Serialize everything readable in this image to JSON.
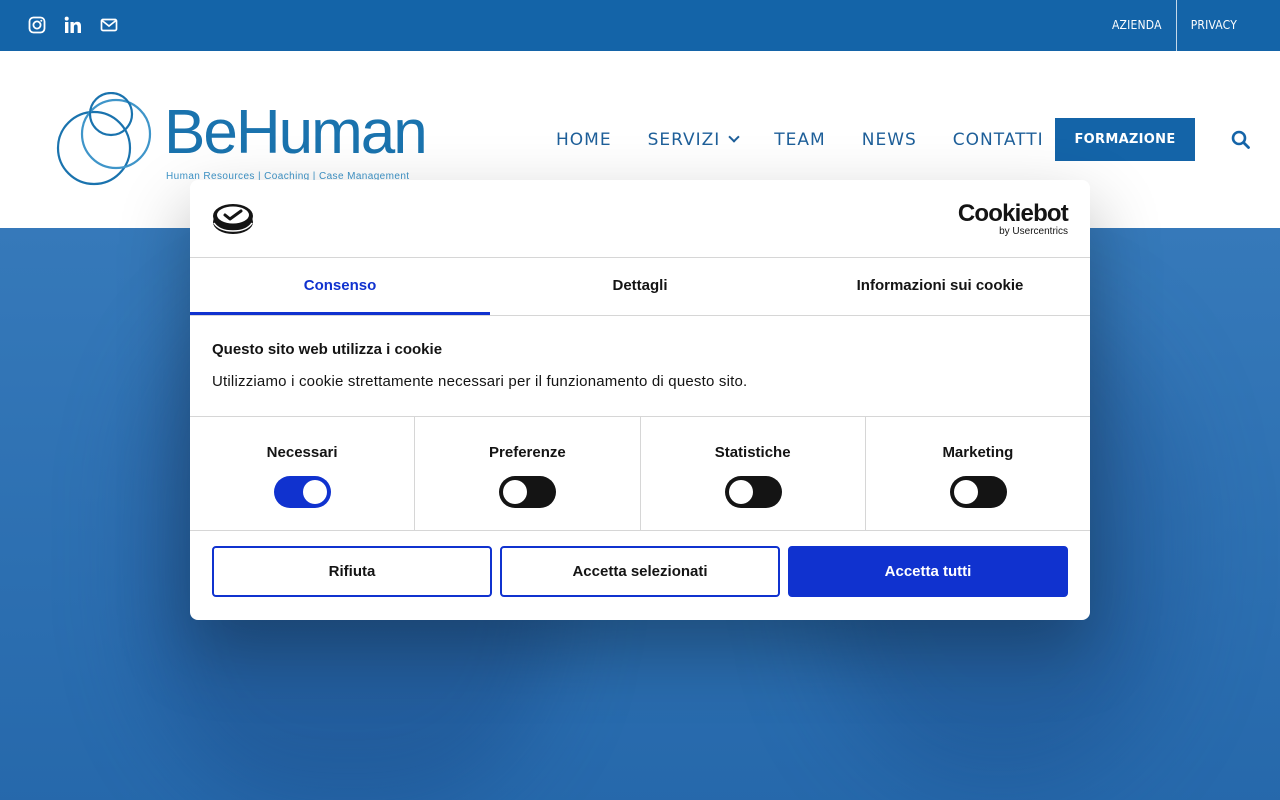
{
  "topbar": {
    "social": [
      "instagram-icon",
      "linkedin-icon",
      "mail-icon"
    ],
    "links": [
      "AZIENDA",
      "PRIVACY"
    ],
    "color": "#1464a8"
  },
  "header": {
    "logo": {
      "word": "BeHuman",
      "tagline": "Human Resources | Coaching | Case Management"
    },
    "nav": [
      "HOME",
      "SERVIZI",
      "TEAM",
      "NEWS",
      "CONTATTI"
    ],
    "cta": "FORMAZIONE",
    "search_icon": "search-icon"
  },
  "cookie": {
    "brand": {
      "name": "Cookiebot",
      "by": "by Usercentrics"
    },
    "tabs": [
      "Consenso",
      "Dettagli",
      "Informazioni sui cookie"
    ],
    "active_tab": "Consenso",
    "title": "Questo sito web utilizza i cookie",
    "text": "Utilizziamo i cookie strettamente necessari per il funzionamento di questo sito.",
    "categories": [
      {
        "label": "Necessari",
        "enabled": true
      },
      {
        "label": "Preferenze",
        "enabled": false
      },
      {
        "label": "Statistiche",
        "enabled": false
      },
      {
        "label": "Marketing",
        "enabled": false
      }
    ],
    "buttons": {
      "reject": "Rifiuta",
      "accept_selected": "Accetta selezionati",
      "accept_all": "Accetta tutti"
    },
    "accent": "#1032cf"
  }
}
